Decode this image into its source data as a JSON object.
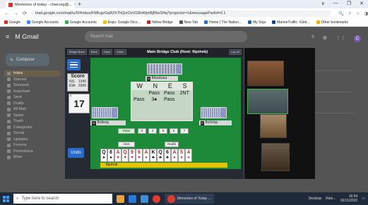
{
  "browser": {
    "tab_title": "Memories of today - chwcorg@...",
    "tab_close": "×",
    "new_tab": "+",
    "win_controls": [
      "∨",
      "—",
      "❐",
      "✕"
    ],
    "nav": [
      "←",
      "→",
      "⟳"
    ],
    "url": "mail.google.com/mail/u/0/#inbox/FMfcgzGqRZhThQvrDzVG8nWprBjRbxSNq?projector=1&messagePartId=0.1",
    "actions": [
      "🔍",
      "⇧",
      "☆",
      "◨"
    ],
    "bookmarks": [
      {
        "label": "Google",
        "color": "#d93025"
      },
      {
        "label": "Google Accounts",
        "color": "#4285f4"
      },
      {
        "label": "Google Accounts",
        "color": "#34a853"
      },
      {
        "label": "Expo: Google Dico...",
        "color": "#fbbc05"
      },
      {
        "label": "Yellow Bridge",
        "color": "#c62828"
      },
      {
        "label": "New Tab",
        "color": "#555555"
      },
      {
        "label": "Home | The Nation...",
        "color": "#1a73e8"
      },
      {
        "label": "My Soja",
        "color": "#1565c0"
      },
      {
        "label": "MarineTraffic: Glob...",
        "color": "#0d47a1"
      },
      {
        "label": "Other bookmarks",
        "color": "#f4b400"
      }
    ]
  },
  "gmail": {
    "menu": "≡",
    "logo": "M Gmail",
    "search_placeholder": "Search mail",
    "compose": "Compose",
    "sidebar": [
      "Inbox",
      "Starred",
      "Snoozed",
      "Important",
      "Sent",
      "Drafts",
      "All Mail",
      "Spam",
      "Trash",
      "Categories",
      "Social",
      "Updates",
      "Forums",
      "Promotions",
      "More"
    ],
    "avatar": "C"
  },
  "bridge": {
    "buttons": [
      "Bridge Base",
      "Back",
      "Hand",
      "Claim"
    ],
    "title": "Main Bridge Club (Host: fbjohnb)",
    "logout": "Log off",
    "score_title": "Score",
    "ns_label": "NS:",
    "ns_value": "1340",
    "ew_label": "EW:",
    "ew_value": "3390",
    "board_number": "17",
    "board_small": "8",
    "undo": "Undo",
    "north": {
      "seat": "N",
      "name": "fbbarbara"
    },
    "west": {
      "seat": "W",
      "name": "fbdiveg"
    },
    "east": {
      "seat": "E",
      "name": "fbchrisp"
    },
    "south": {
      "seat": "S",
      "name": "fbjohnb"
    },
    "auction_header": [
      "W",
      "N",
      "E",
      "S"
    ],
    "auction_rows": [
      [
        "",
        "Pass",
        "Pass",
        "2NT"
      ],
      [
        "Pass",
        "3♠",
        "Pass",
        ""
      ]
    ],
    "bid_pass": "Pass",
    "bid_levels": [
      "3",
      "4",
      "5",
      "6",
      "7"
    ],
    "bid_alert": "Alert",
    "bid_redbl": "Redbl",
    "hand": [
      {
        "rank": "Q",
        "suit": "♠",
        "color": "blk"
      },
      {
        "rank": "8",
        "suit": "♠",
        "color": "blk"
      },
      {
        "rank": "A",
        "suit": "♥",
        "color": "red"
      },
      {
        "rank": "Q",
        "suit": "♥",
        "color": "red"
      },
      {
        "rank": "9",
        "suit": "♥",
        "color": "red"
      },
      {
        "rank": "6",
        "suit": "♥",
        "color": "red"
      },
      {
        "rank": "A",
        "suit": "♦",
        "color": "red"
      },
      {
        "rank": "K",
        "suit": "♣",
        "color": "blk"
      },
      {
        "rank": "Q",
        "suit": "♣",
        "color": "blk"
      },
      {
        "rank": "6",
        "suit": "♣",
        "color": "blk"
      },
      {
        "rank": "A",
        "suit": "♦",
        "color": "red"
      },
      {
        "rank": "5",
        "suit": "♦",
        "color": "red"
      },
      {
        "rank": "4",
        "suit": "♦",
        "color": "red"
      }
    ]
  },
  "taskbar": {
    "search_placeholder": "Type here to search",
    "active_window": "Memories of Today ...",
    "desktop": "Desktop",
    "weather": "Rain...",
    "time": "16:54",
    "date": "16/11/2022"
  }
}
